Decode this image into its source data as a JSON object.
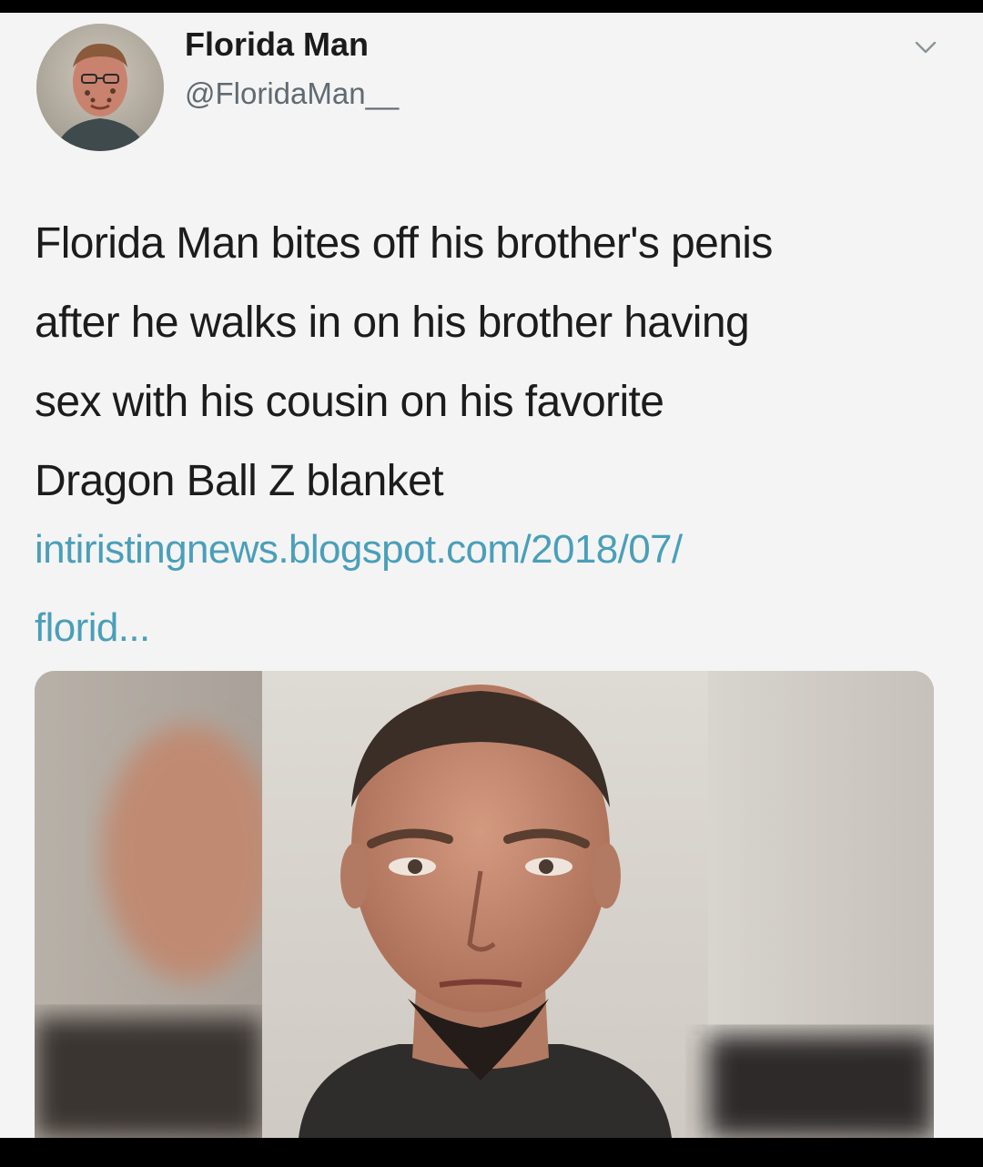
{
  "tweet": {
    "display_name": "Florida Man",
    "handle": "@FloridaMan__",
    "text_lines": [
      "Florida Man bites off his brother's penis",
      "after he walks in on his brother having",
      "sex with his cousin on his favorite",
      "Dragon Ball Z blanket"
    ],
    "link_lines": [
      "intiristingnews.blogspot.com/2018/07/",
      "florid..."
    ]
  },
  "icons": {
    "more": "chevron-down-icon"
  },
  "colors": {
    "background": "#f4f4f4",
    "text": "#1c1c1c",
    "handle": "#606a72",
    "link": "#4a9fb9"
  }
}
